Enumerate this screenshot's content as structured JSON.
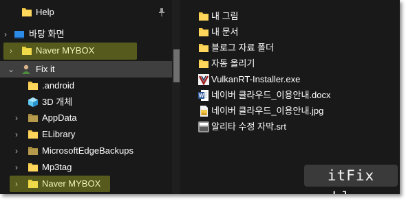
{
  "nav": {
    "items": [
      {
        "label": "Help"
      },
      {
        "label": "바탕 화면"
      },
      {
        "label": "Naver MYBOX"
      },
      {
        "label": "Fix it"
      },
      {
        "label": ".android"
      },
      {
        "label": "3D 개체"
      },
      {
        "label": "AppData"
      },
      {
        "label": "ELibrary"
      },
      {
        "label": "MicrosoftEdgeBackups"
      },
      {
        "label": "Mp3tag"
      },
      {
        "label": "Naver MYBOX"
      }
    ]
  },
  "files": [
    {
      "name": "내 그림",
      "icon": "folder-icon"
    },
    {
      "name": "내 문서",
      "icon": "folder-icon"
    },
    {
      "name": "블로그 자료 폴더",
      "icon": "folder-icon"
    },
    {
      "name": "자동 올리기",
      "icon": "folder-icon"
    },
    {
      "name": "VulkanRT-Installer.exe",
      "icon": "vulkan-exe-icon"
    },
    {
      "name": "네이버 클라우드_이용안내.docx",
      "icon": "word-docx-icon"
    },
    {
      "name": "네이버 클라우드_이용안내.jpg",
      "icon": "jpg-image-icon"
    },
    {
      "name": "알리타 수정 자막.srt",
      "icon": "srt-file-icon"
    }
  ],
  "watermark": "itFix blog",
  "colors": {
    "background": "#191919",
    "selected_row": "#3f3f3f",
    "folder": "#f3c94a",
    "highlight": "#d6e428"
  }
}
